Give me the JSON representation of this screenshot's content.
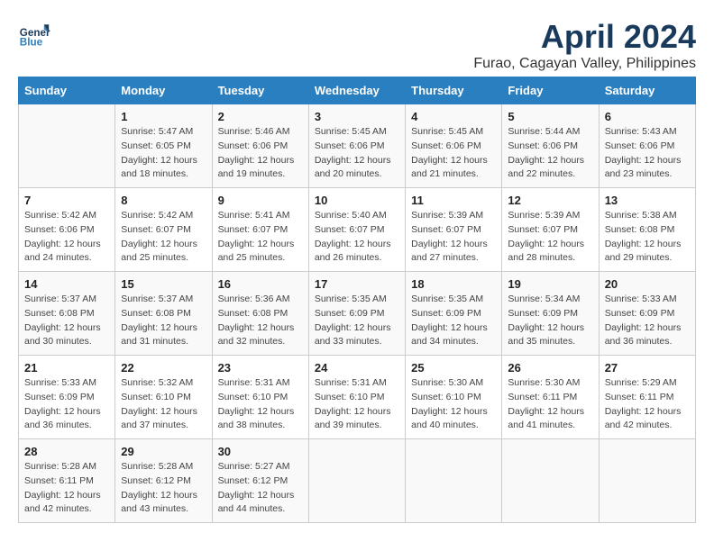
{
  "header": {
    "logo_line1": "General",
    "logo_line2": "Blue",
    "main_title": "April 2024",
    "subtitle": "Furao, Cagayan Valley, Philippines"
  },
  "days_of_week": [
    "Sunday",
    "Monday",
    "Tuesday",
    "Wednesday",
    "Thursday",
    "Friday",
    "Saturday"
  ],
  "weeks": [
    [
      {
        "day": "",
        "info": ""
      },
      {
        "day": "1",
        "info": "Sunrise: 5:47 AM\nSunset: 6:05 PM\nDaylight: 12 hours\nand 18 minutes."
      },
      {
        "day": "2",
        "info": "Sunrise: 5:46 AM\nSunset: 6:06 PM\nDaylight: 12 hours\nand 19 minutes."
      },
      {
        "day": "3",
        "info": "Sunrise: 5:45 AM\nSunset: 6:06 PM\nDaylight: 12 hours\nand 20 minutes."
      },
      {
        "day": "4",
        "info": "Sunrise: 5:45 AM\nSunset: 6:06 PM\nDaylight: 12 hours\nand 21 minutes."
      },
      {
        "day": "5",
        "info": "Sunrise: 5:44 AM\nSunset: 6:06 PM\nDaylight: 12 hours\nand 22 minutes."
      },
      {
        "day": "6",
        "info": "Sunrise: 5:43 AM\nSunset: 6:06 PM\nDaylight: 12 hours\nand 23 minutes."
      }
    ],
    [
      {
        "day": "7",
        "info": "Sunrise: 5:42 AM\nSunset: 6:06 PM\nDaylight: 12 hours\nand 24 minutes."
      },
      {
        "day": "8",
        "info": "Sunrise: 5:42 AM\nSunset: 6:07 PM\nDaylight: 12 hours\nand 25 minutes."
      },
      {
        "day": "9",
        "info": "Sunrise: 5:41 AM\nSunset: 6:07 PM\nDaylight: 12 hours\nand 25 minutes."
      },
      {
        "day": "10",
        "info": "Sunrise: 5:40 AM\nSunset: 6:07 PM\nDaylight: 12 hours\nand 26 minutes."
      },
      {
        "day": "11",
        "info": "Sunrise: 5:39 AM\nSunset: 6:07 PM\nDaylight: 12 hours\nand 27 minutes."
      },
      {
        "day": "12",
        "info": "Sunrise: 5:39 AM\nSunset: 6:07 PM\nDaylight: 12 hours\nand 28 minutes."
      },
      {
        "day": "13",
        "info": "Sunrise: 5:38 AM\nSunset: 6:08 PM\nDaylight: 12 hours\nand 29 minutes."
      }
    ],
    [
      {
        "day": "14",
        "info": "Sunrise: 5:37 AM\nSunset: 6:08 PM\nDaylight: 12 hours\nand 30 minutes."
      },
      {
        "day": "15",
        "info": "Sunrise: 5:37 AM\nSunset: 6:08 PM\nDaylight: 12 hours\nand 31 minutes."
      },
      {
        "day": "16",
        "info": "Sunrise: 5:36 AM\nSunset: 6:08 PM\nDaylight: 12 hours\nand 32 minutes."
      },
      {
        "day": "17",
        "info": "Sunrise: 5:35 AM\nSunset: 6:09 PM\nDaylight: 12 hours\nand 33 minutes."
      },
      {
        "day": "18",
        "info": "Sunrise: 5:35 AM\nSunset: 6:09 PM\nDaylight: 12 hours\nand 34 minutes."
      },
      {
        "day": "19",
        "info": "Sunrise: 5:34 AM\nSunset: 6:09 PM\nDaylight: 12 hours\nand 35 minutes."
      },
      {
        "day": "20",
        "info": "Sunrise: 5:33 AM\nSunset: 6:09 PM\nDaylight: 12 hours\nand 36 minutes."
      }
    ],
    [
      {
        "day": "21",
        "info": "Sunrise: 5:33 AM\nSunset: 6:09 PM\nDaylight: 12 hours\nand 36 minutes."
      },
      {
        "day": "22",
        "info": "Sunrise: 5:32 AM\nSunset: 6:10 PM\nDaylight: 12 hours\nand 37 minutes."
      },
      {
        "day": "23",
        "info": "Sunrise: 5:31 AM\nSunset: 6:10 PM\nDaylight: 12 hours\nand 38 minutes."
      },
      {
        "day": "24",
        "info": "Sunrise: 5:31 AM\nSunset: 6:10 PM\nDaylight: 12 hours\nand 39 minutes."
      },
      {
        "day": "25",
        "info": "Sunrise: 5:30 AM\nSunset: 6:10 PM\nDaylight: 12 hours\nand 40 minutes."
      },
      {
        "day": "26",
        "info": "Sunrise: 5:30 AM\nSunset: 6:11 PM\nDaylight: 12 hours\nand 41 minutes."
      },
      {
        "day": "27",
        "info": "Sunrise: 5:29 AM\nSunset: 6:11 PM\nDaylight: 12 hours\nand 42 minutes."
      }
    ],
    [
      {
        "day": "28",
        "info": "Sunrise: 5:28 AM\nSunset: 6:11 PM\nDaylight: 12 hours\nand 42 minutes."
      },
      {
        "day": "29",
        "info": "Sunrise: 5:28 AM\nSunset: 6:12 PM\nDaylight: 12 hours\nand 43 minutes."
      },
      {
        "day": "30",
        "info": "Sunrise: 5:27 AM\nSunset: 6:12 PM\nDaylight: 12 hours\nand 44 minutes."
      },
      {
        "day": "",
        "info": ""
      },
      {
        "day": "",
        "info": ""
      },
      {
        "day": "",
        "info": ""
      },
      {
        "day": "",
        "info": ""
      }
    ]
  ]
}
